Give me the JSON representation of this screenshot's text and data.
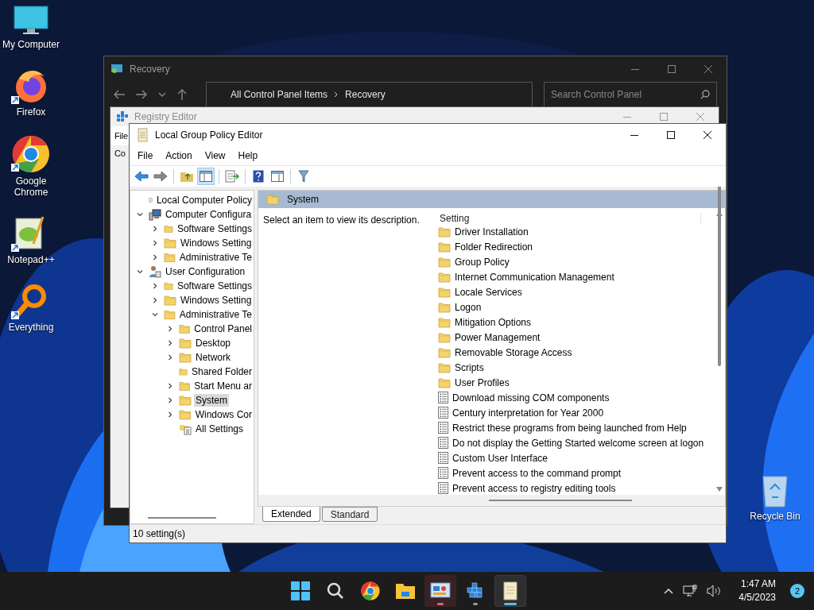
{
  "desktop_icons": [
    {
      "label": "My Computer",
      "kind": "computer",
      "shortcut": false
    },
    {
      "label": "Firefox",
      "kind": "firefox",
      "shortcut": true
    },
    {
      "label": "Google Chrome",
      "kind": "chrome",
      "shortcut": true
    },
    {
      "label": "Notepad++",
      "kind": "notepad",
      "shortcut": true
    },
    {
      "label": "Everything",
      "kind": "everything",
      "shortcut": true
    }
  ],
  "recycle_bin": {
    "label": "Recycle Bin"
  },
  "recovery_window": {
    "title": "Recovery",
    "address": [
      "All Control Panel Items",
      "Recovery"
    ],
    "search": {
      "placeholder": "Search Control Panel"
    }
  },
  "registry_window": {
    "title": "Registry Editor",
    "menu": [
      "File"
    ],
    "address_bar": "Co"
  },
  "gpedit": {
    "title": "Local Group Policy Editor",
    "menu": [
      "File",
      "Action",
      "View",
      "Help"
    ],
    "tree": {
      "label": "Local Computer Policy",
      "kind": "policy-root",
      "selected": false,
      "children": [
        {
          "label": "Computer Configura",
          "kind": "computer",
          "expanded": true,
          "selected": false,
          "children": [
            {
              "label": "Software Settings",
              "kind": "folder",
              "expanded": false,
              "selected": false
            },
            {
              "label": "Windows Setting",
              "kind": "folder",
              "expanded": false,
              "selected": false
            },
            {
              "label": "Administrative Te",
              "kind": "folder",
              "expanded": false,
              "selected": false
            }
          ]
        },
        {
          "label": "User Configuration",
          "kind": "user",
          "expanded": true,
          "selected": false,
          "children": [
            {
              "label": "Software Settings",
              "kind": "folder",
              "expanded": false,
              "selected": false
            },
            {
              "label": "Windows Setting",
              "kind": "folder",
              "expanded": false,
              "selected": false
            },
            {
              "label": "Administrative Te",
              "kind": "folder",
              "expanded": true,
              "selected": false,
              "children": [
                {
                  "label": "Control Panel",
                  "kind": "folder",
                  "expanded": false,
                  "selected": false
                },
                {
                  "label": "Desktop",
                  "kind": "folder",
                  "expanded": false,
                  "selected": false
                },
                {
                  "label": "Network",
                  "kind": "folder",
                  "expanded": false,
                  "selected": false
                },
                {
                  "label": "Shared Folder",
                  "kind": "folder",
                  "selected": false
                },
                {
                  "label": "Start Menu ar",
                  "kind": "folder",
                  "expanded": false,
                  "selected": false
                },
                {
                  "label": "System",
                  "kind": "folder",
                  "expanded": false,
                  "selected": true
                },
                {
                  "label": "Windows Cor",
                  "kind": "folder",
                  "expanded": false,
                  "selected": false
                },
                {
                  "label": "All Settings",
                  "kind": "settings",
                  "selected": false
                }
              ]
            }
          ]
        }
      ]
    },
    "header": "System",
    "description": "Select an item to view its description.",
    "list_header": "Setting",
    "settings": [
      {
        "name": "Driver Installation",
        "kind": "folder"
      },
      {
        "name": "Folder Redirection",
        "kind": "folder"
      },
      {
        "name": "Group Policy",
        "kind": "folder"
      },
      {
        "name": "Internet Communication Management",
        "kind": "folder"
      },
      {
        "name": "Locale Services",
        "kind": "folder"
      },
      {
        "name": "Logon",
        "kind": "folder"
      },
      {
        "name": "Mitigation Options",
        "kind": "folder"
      },
      {
        "name": "Power Management",
        "kind": "folder"
      },
      {
        "name": "Removable Storage Access",
        "kind": "folder"
      },
      {
        "name": "Scripts",
        "kind": "folder"
      },
      {
        "name": "User Profiles",
        "kind": "folder"
      },
      {
        "name": "Download missing COM components",
        "kind": "policy"
      },
      {
        "name": "Century interpretation for Year 2000",
        "kind": "policy"
      },
      {
        "name": "Restrict these programs from being launched from Help",
        "kind": "policy"
      },
      {
        "name": "Do not display the Getting Started welcome screen at logon",
        "kind": "policy"
      },
      {
        "name": "Custom User Interface",
        "kind": "policy"
      },
      {
        "name": "Prevent access to the command prompt",
        "kind": "policy"
      },
      {
        "name": "Prevent access to registry editing tools",
        "kind": "policy"
      }
    ],
    "tabs": [
      {
        "label": "Extended",
        "selected": true
      },
      {
        "label": "Standard",
        "selected": false
      }
    ],
    "status": "10 setting(s)"
  },
  "taskbar": {
    "apps": [
      {
        "kind": "start",
        "open": false,
        "active": false,
        "flashing": false
      },
      {
        "kind": "search",
        "open": false,
        "active": false,
        "flashing": false
      },
      {
        "kind": "chrome",
        "open": false,
        "active": false,
        "flashing": false
      },
      {
        "kind": "explorer",
        "open": false,
        "active": false,
        "flashing": false
      },
      {
        "kind": "control-panel",
        "open": true,
        "active": false,
        "flashing": true
      },
      {
        "kind": "registry",
        "open": true,
        "active": false,
        "flashing": false
      },
      {
        "kind": "gpedit",
        "open": true,
        "active": true,
        "flashing": false
      }
    ],
    "time": "1:47 AM",
    "date": "4/5/2023",
    "notifications": "2"
  }
}
